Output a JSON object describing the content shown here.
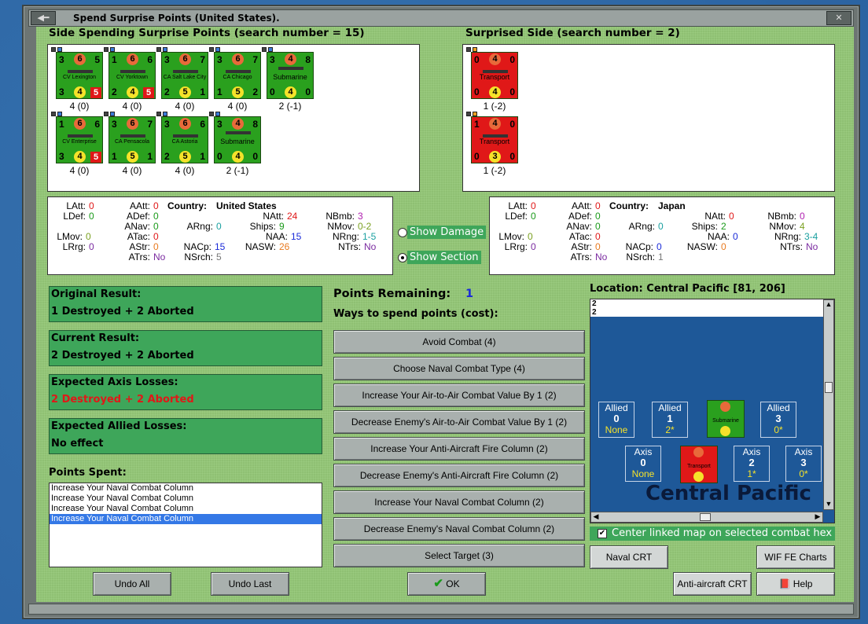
{
  "window": {
    "title": "Spend Surprise Points (United States)."
  },
  "left_header": "Side Spending Surprise Points (search number = 15)",
  "right_header": "Surprised Side (search number = 2)",
  "colors": {
    "friendly": "#2aa01e",
    "enemy": "#e01818",
    "result_green": "#3ea65a"
  },
  "left_counters": [
    {
      "tl": "3",
      "top": "6",
      "tr": "5",
      "name": "CV Lexington",
      "bl": "3",
      "mid": "4",
      "br": "5",
      "val": "4 (0)"
    },
    {
      "tl": "1",
      "top": "6",
      "tr": "6",
      "name": "CV Yorktown",
      "bl": "2",
      "mid": "4",
      "br": "5",
      "val": "4 (0)"
    },
    {
      "tl": "3",
      "top": "6",
      "tr": "7",
      "name": "CA Salt Lake City",
      "bl": "2",
      "mid": "5",
      "br": "1",
      "val": "4 (0)"
    },
    {
      "tl": "3",
      "top": "6",
      "tr": "7",
      "name": "CA Chicago",
      "bl": "1",
      "mid": "5",
      "br": "2",
      "val": "4 (0)"
    },
    {
      "tl": "3",
      "top": "4",
      "tr": "8",
      "name": "Submarine",
      "bl": "0",
      "mid": "4",
      "br": "0",
      "val": "2 (-1)"
    },
    {
      "tl": "1",
      "top": "6",
      "tr": "6",
      "name": "CV Enterprise",
      "bl": "3",
      "mid": "4",
      "br": "5",
      "val": "4 (0)"
    },
    {
      "tl": "3",
      "top": "6",
      "tr": "7",
      "name": "CA Pensacola",
      "bl": "1",
      "mid": "5",
      "br": "1",
      "val": "4 (0)"
    },
    {
      "tl": "3",
      "top": "6",
      "tr": "6",
      "name": "CA Astoria",
      "bl": "2",
      "mid": "5",
      "br": "1",
      "val": "4 (0)"
    },
    {
      "tl": "3",
      "top": "4",
      "tr": "8",
      "name": "Submarine",
      "bl": "0",
      "mid": "4",
      "br": "0",
      "val": "2 (-1)"
    }
  ],
  "right_counters": [
    {
      "tl": "0",
      "top": "4",
      "tr": "0",
      "name": "Transport",
      "bl": "0",
      "mid": "4",
      "br": "0",
      "val": "1 (-2)"
    },
    {
      "tl": "1",
      "top": "4",
      "tr": "0",
      "name": "Transport",
      "bl": "0",
      "mid": "3",
      "br": "0",
      "val": "1 (-2)"
    }
  ],
  "us_stats": {
    "latt": "0",
    "ldef": "0",
    "lmov": "0",
    "lrrg": "0",
    "aatt": "0",
    "adef": "0",
    "anav": "0",
    "atac": "0",
    "astr": "0",
    "atrs": "No",
    "country_label": "Country:",
    "country": "United States",
    "arng": "0",
    "natt": "24",
    "ships": "9",
    "naa": "15",
    "nasw": "26",
    "nacp": "15",
    "nsrch": "5",
    "nbmb": "3",
    "nmov": "0-2",
    "nrng": "1-5",
    "ntrs": "No"
  },
  "jp_stats": {
    "latt": "0",
    "ldef": "0",
    "lmov": "0",
    "lrrg": "0",
    "aatt": "0",
    "adef": "0",
    "anav": "0",
    "atac": "0",
    "astr": "0",
    "atrs": "No",
    "country_label": "Country:",
    "country": "Japan",
    "arng": "0",
    "natt": "0",
    "ships": "2",
    "naa": "0",
    "nasw": "0",
    "nacp": "0",
    "nsrch": "1",
    "nbmb": "0",
    "nmov": "4",
    "nrng": "3-4",
    "ntrs": "No"
  },
  "stat_labels": {
    "latt": "LAtt:",
    "ldef": "LDef:",
    "lmov": "LMov:",
    "lrrg": "LRrg:",
    "aatt": "AAtt:",
    "adef": "ADef:",
    "anav": "ANav:",
    "atac": "ATac:",
    "astr": "AStr:",
    "atrs": "ATrs:",
    "arng": "ARng:",
    "natt": "NAtt:",
    "ships": "Ships:",
    "naa": "NAA:",
    "nasw": "NASW:",
    "nacp": "NACp:",
    "nsrch": "NSrch:",
    "nbmb": "NBmb:",
    "nmov": "NMov:",
    "nrng": "NRng:",
    "ntrs": "NTrs:"
  },
  "options": {
    "show_damage": "Show Damage",
    "show_section": "Show Section"
  },
  "results": {
    "original_label": "Original Result:",
    "original": "1 Destroyed + 2 Aborted",
    "current_label": "Current Result:",
    "current": "2 Destroyed + 2 Aborted",
    "axis_label": "Expected Axis Losses:",
    "axis": "2 Destroyed + 2 Aborted",
    "allied_label": "Expected Allied Losses:",
    "allied": "No effect"
  },
  "points_spent_label": "Points Spent:",
  "points_spent": [
    "Increase Your Naval Combat Column",
    "Increase Your Naval Combat Column",
    "Increase Your Naval Combat Column",
    "Increase Your Naval Combat Column"
  ],
  "points_remaining_label": "Points Remaining:",
  "points_remaining": "1",
  "ways_label": "Ways to spend points (cost):",
  "ways": [
    "Avoid Combat (4)",
    "Choose Naval Combat Type (4)",
    "Increase Your Air-to-Air Combat Value By 1 (2)",
    "Decrease Enemy's Air-to-Air Combat Value By 1 (2)",
    "Increase Your Anti-Aircraft Fire Column (2)",
    "Decrease Enemy's Anti-Aircraft Fire Column (2)",
    "Increase Your Naval Combat Column (2)",
    "Decrease Enemy's Naval Combat Column (2)",
    "Select Target (3)"
  ],
  "location_label": "Location: Central Pacific [81, 206]",
  "map": {
    "sea_name": "Central Pacific",
    "allied_boxes": [
      {
        "t": "Allied",
        "n": "0",
        "s": "None"
      },
      {
        "t": "Allied",
        "n": "1",
        "s": "2*"
      },
      {
        "t": "Allied",
        "n": "3",
        "s": "0*"
      }
    ],
    "axis_boxes": [
      {
        "t": "Axis",
        "n": "0",
        "s": "None"
      },
      {
        "t": "Axis",
        "n": "2",
        "s": "1*"
      },
      {
        "t": "Axis",
        "n": "3",
        "s": "0*"
      }
    ],
    "allied_stack": "2",
    "axis_stack": "2",
    "sub_label": "Submarine",
    "transport_label": "Transport"
  },
  "center_map_label": "Center linked map on selected combat hex",
  "buttons": {
    "undo_all": "Undo All",
    "undo_last": "Undo Last",
    "ok": "OK",
    "naval_crt": "Naval CRT",
    "wif_charts": "WIF FE Charts",
    "aa_crt": "Anti-aircraft CRT",
    "help": "Help"
  }
}
